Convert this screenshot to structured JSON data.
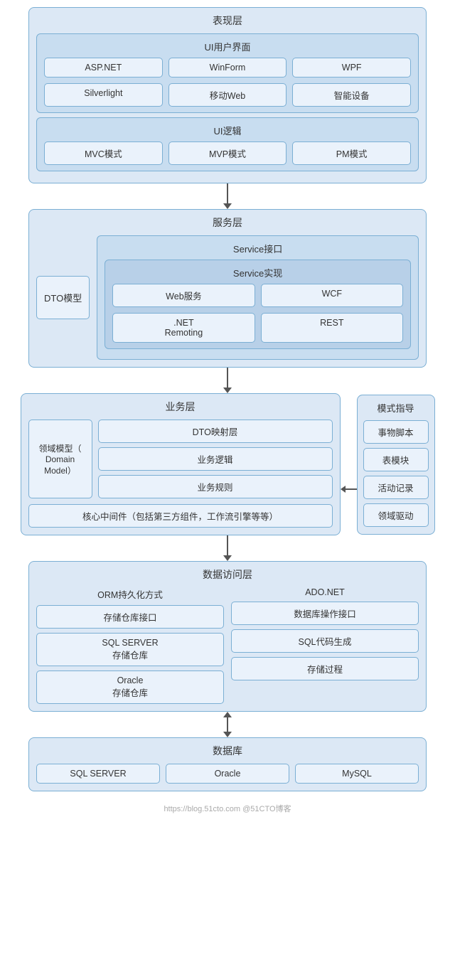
{
  "layers": {
    "presentation": {
      "title": "表现层",
      "ui_section": {
        "title": "UI用户界面",
        "row1": [
          "ASP.NET",
          "WinForm",
          "WPF"
        ],
        "row2": [
          "Silverlight",
          "移动Web",
          "智能设备"
        ]
      },
      "logic_section": {
        "title": "UI逻辑",
        "items": [
          "MVC模式",
          "MVP模式",
          "PM模式"
        ]
      }
    },
    "service": {
      "title": "服务层",
      "dto": "DTO模型",
      "service_interface": "Service接口",
      "service_impl": {
        "title": "Service实现",
        "row1": [
          "Web服务",
          "WCF"
        ],
        "row2": [
          ".NET\nRemoting",
          "REST"
        ]
      }
    },
    "business": {
      "title": "业务层",
      "domain": "领域模型（\nDomain\nModel）",
      "dto_mapping": "DTO映射层",
      "business_logic": "业务逻辑",
      "business_rules": "业务规则",
      "core_middleware": "核心中间件（包括第三方组件，工作流引擎等等）",
      "side_panel": {
        "title": "模式指导",
        "items": [
          "事物脚本",
          "表模块",
          "活动记录",
          "领域驱动"
        ]
      }
    },
    "data_access": {
      "title": "数据访问层",
      "orm": {
        "title": "ORM持久化方式",
        "items": [
          "存储仓库接口",
          "SQL SERVER\n存储仓库",
          "Oracle\n存储仓库"
        ]
      },
      "ado": {
        "title": "ADO.NET",
        "items": [
          "数据库操作接口",
          "SQL代码生成",
          "存储过程"
        ]
      }
    },
    "database": {
      "title": "数据库",
      "items": [
        "SQL SERVER",
        "Oracle",
        "MySQL"
      ]
    }
  },
  "footer": {
    "url": "https://blog.51cto.com",
    "brand": "@51CTO博客"
  }
}
